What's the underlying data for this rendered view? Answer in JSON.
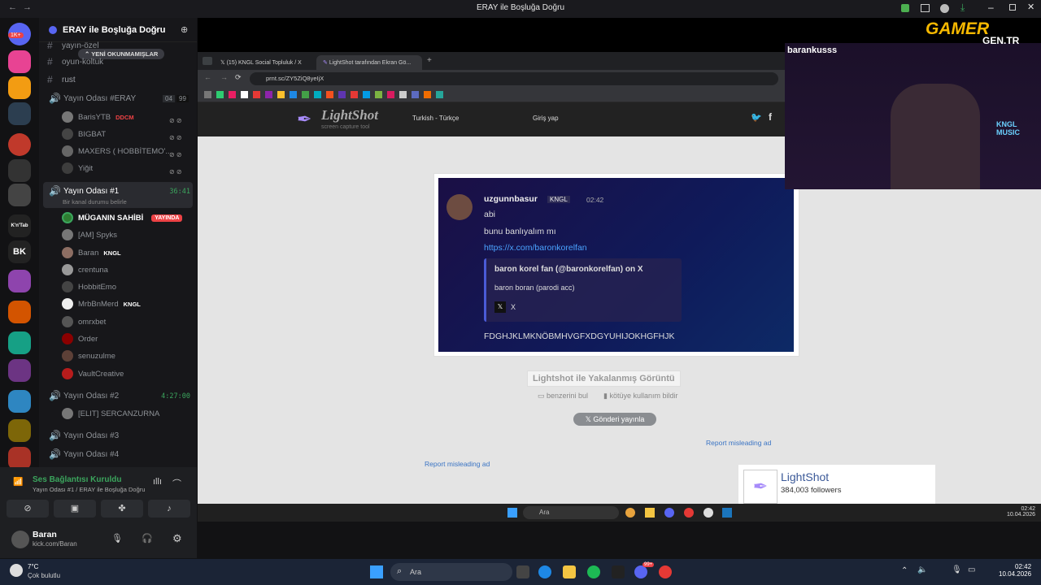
{
  "window": {
    "title": "ERAY ile Boşluğa Doğru"
  },
  "server": {
    "name": "ERAY ile Boşluğa Doğru",
    "unread_pill": "YENİ OKUNMAMIŞLAR",
    "rail_badge": "1K+",
    "rail_labels": [
      "K'n'Tab",
      "BK"
    ]
  },
  "channels": {
    "top": [
      {
        "name": "yayın-özel"
      },
      {
        "name": "oyun-koltuk"
      },
      {
        "name": "rust"
      }
    ],
    "eray": {
      "name": "Yayın Odası #ERAY",
      "count_a": "04",
      "count_b": "99",
      "users": [
        {
          "name": "BarisYTB",
          "tag": "DDCM"
        },
        {
          "name": "BIGBAT"
        },
        {
          "name": "MAXERS ( HOBBİTEMO'..."
        },
        {
          "name": "Yiğit"
        }
      ]
    },
    "room1": {
      "name": "Yayın Odası #1",
      "time": "36:41",
      "status": "Bir kanal durumu belirle",
      "users": [
        {
          "name": "MÜGANIN SAHİBİ",
          "badge": "YAYINDA"
        },
        {
          "name": "[AM] Spyks"
        },
        {
          "name": "Baran",
          "tag": "KNGL"
        },
        {
          "name": "crentuna"
        },
        {
          "name": "HobbitEmo"
        },
        {
          "name": "MrbBnMerd",
          "tag": "KNGL"
        },
        {
          "name": "omrxbet"
        },
        {
          "name": "Order"
        },
        {
          "name": "senuzulme"
        },
        {
          "name": "VaultCreative"
        }
      ]
    },
    "room2": {
      "name": "Yayın Odası #2",
      "time": "4:27:00",
      "users": [
        {
          "name": "[ELIT] SERCANZURNA"
        }
      ]
    },
    "room3": {
      "name": "Yayın Odası #3"
    },
    "room4": {
      "name": "Yayın Odası #4"
    }
  },
  "voice": {
    "status": "Ses Bağlantısı Kuruldu",
    "detail": "Yayın Odası #1 / ERAY ile Boşluğa Doğru"
  },
  "me": {
    "name": "Baran",
    "sub": "kick.com/Baran"
  },
  "browser": {
    "tabs": [
      {
        "label": "(15) KNGL Social Topluluk / X"
      },
      {
        "label": "LightShot tarafından Ekran Gö..."
      }
    ],
    "url": "prnt.sc/ZY5ZiQ8yeIjX",
    "lightshot": {
      "logo": "LightShot",
      "tagline": "screen capture tool",
      "lang": "Turkish - Türkçe",
      "login": "Giriş yap"
    },
    "caption": "Lightshot ile Yakalanmış Görüntü",
    "similar": "benzerini bul",
    "report_abuse": "kötüye kullanım bildir",
    "post_btn": "Gönderi yayınla",
    "ad1": "Report misleading ad",
    "ad2": "Report misleading ad",
    "fb": {
      "name": "LightShot",
      "followers": "384,003 followers"
    },
    "search": "Ara",
    "clock_time": "02:42",
    "clock_date": "10.04.2026"
  },
  "message": {
    "author": "uzgunnbasur",
    "tag": "KNGL",
    "time": "02:42",
    "lines": [
      "abi",
      "bunu banlıyalım mı"
    ],
    "link": "https://x.com/baronkorelfan",
    "embed": {
      "title": "baron korel fan (@baronkorelfan) on X",
      "desc": "baron boran (parodi acc)",
      "site": "X"
    },
    "tail": "FDGHJKLMKNÖBMHVGFXDGYUHIJOKHGFHJK"
  },
  "stream": {
    "streamer": "barankusss",
    "logo1": "GAMER",
    "logo2": "GEN.TR",
    "sign": "KNGL MUSIC"
  },
  "taskbar": {
    "weather_temp": "7°C",
    "weather_desc": "Çok bulutlu",
    "search": "Ara",
    "time": "02:42",
    "date": "10.04.2026",
    "badge": "99+"
  },
  "colors": {
    "accent": "#3ba55d",
    "live": "#ed4245",
    "brand": "#5865f2"
  }
}
